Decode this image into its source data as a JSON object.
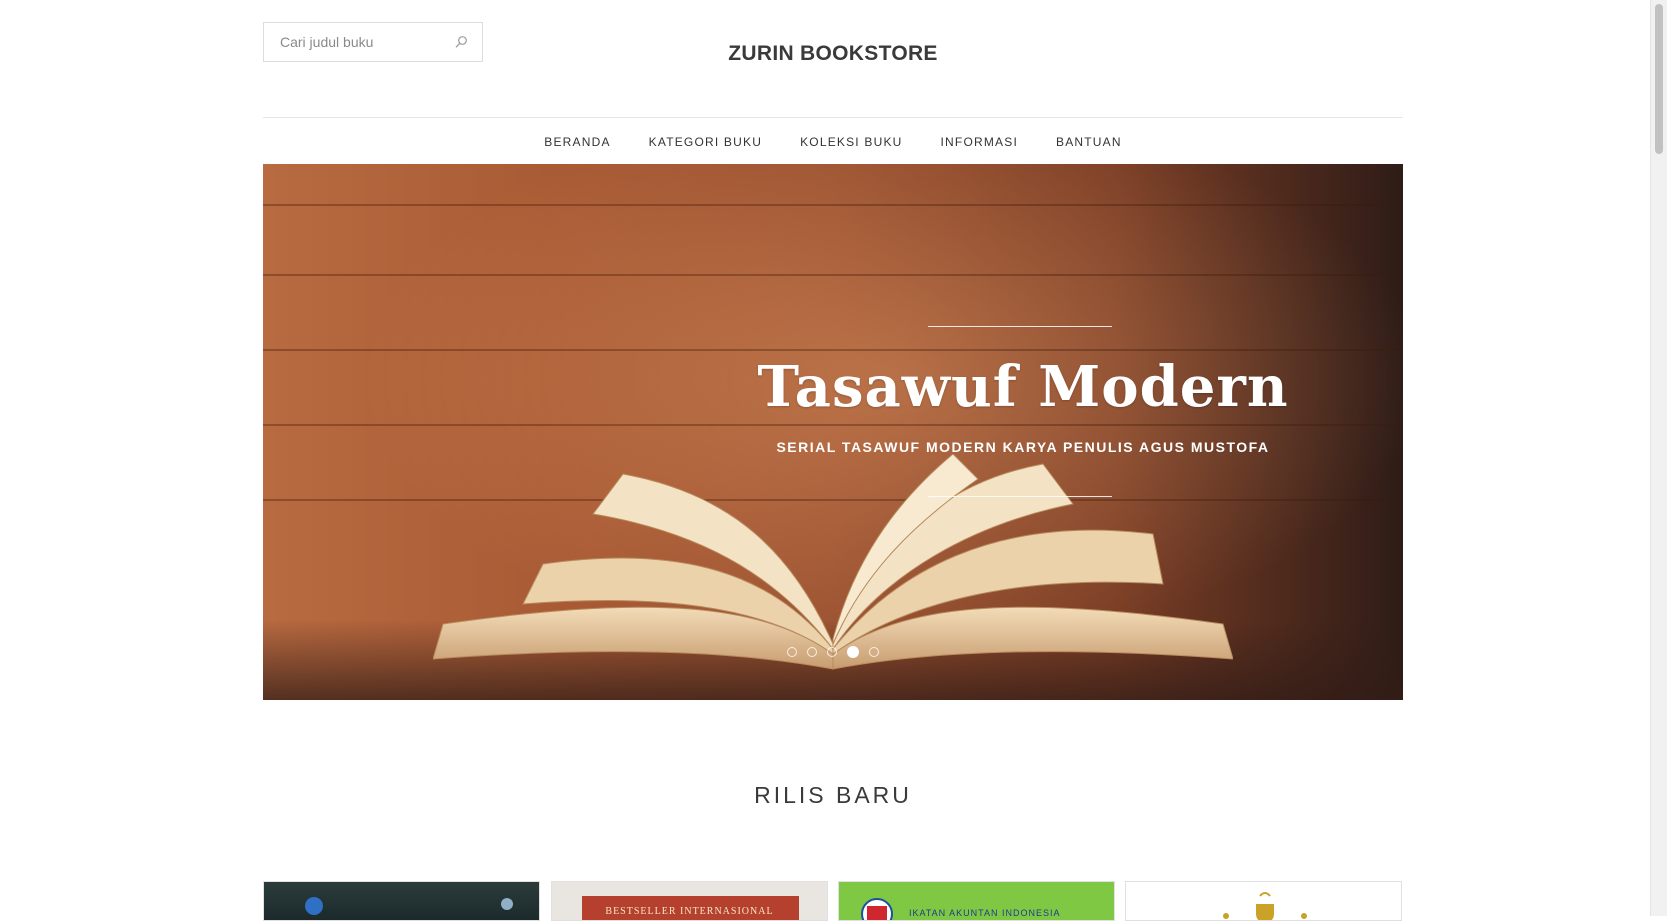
{
  "header": {
    "search_placeholder": "Cari judul buku",
    "site_title": "ZURIN BOOKSTORE"
  },
  "nav": {
    "items": [
      {
        "label": "BERANDA"
      },
      {
        "label": "KATEGORI BUKU"
      },
      {
        "label": "KOLEKSI BUKU"
      },
      {
        "label": "INFORMASI"
      },
      {
        "label": "BANTUAN"
      }
    ]
  },
  "hero": {
    "title": "Tasawuf Modern",
    "subtitle": "SERIAL TASAWUF MODERN KARYA PENULIS AGUS MUSTOFA",
    "slide_count": 5,
    "active_slide": 4
  },
  "new_releases": {
    "title": "RILIS BARU",
    "books": [
      {
        "cover_text": ""
      },
      {
        "cover_text": "BESTSELLER INTERNASIONAL"
      },
      {
        "cover_text": "IKATAN AKUNTAN INDONESIA"
      },
      {
        "cover_text": ""
      }
    ]
  },
  "colors": {
    "text": "#333333",
    "border": "#e6e6e6",
    "hero_wood": "#a95b35",
    "book2_cover": "#b5402e",
    "book3_cover": "#7ec843",
    "book4_accent": "#c9a227"
  },
  "icons": {
    "search": "search-icon"
  }
}
